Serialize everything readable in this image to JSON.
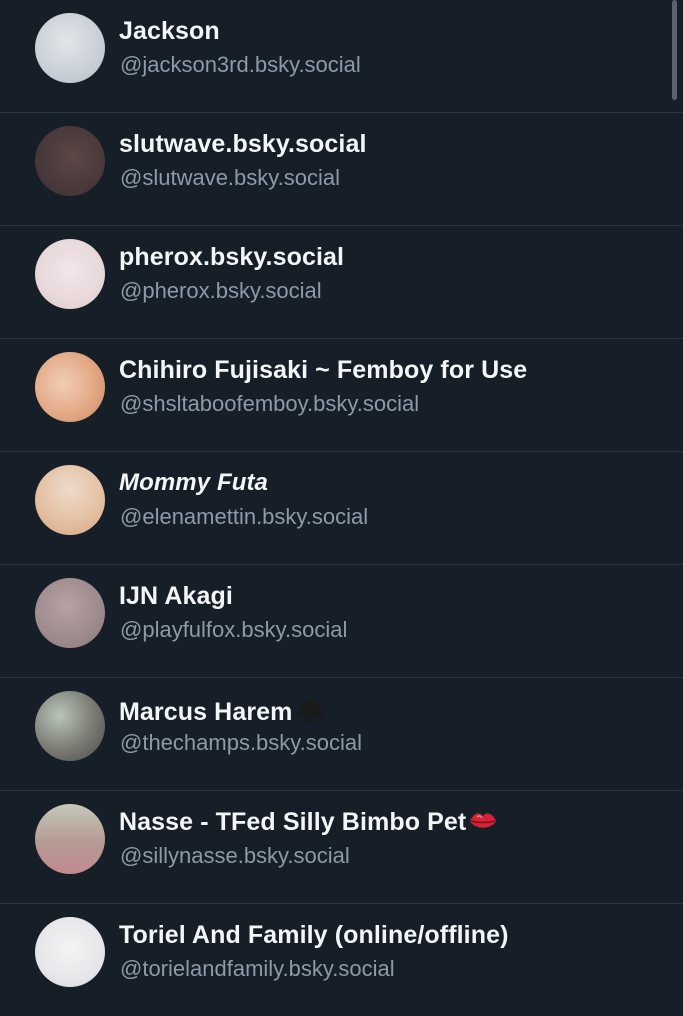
{
  "accounts": [
    {
      "name": "Jackson",
      "handle": "@jackson3rd.bsky.social"
    },
    {
      "name": "slutwave.bsky.social",
      "handle": "@slutwave.bsky.social"
    },
    {
      "name": "pherox.bsky.social",
      "handle": "@pherox.bsky.social"
    },
    {
      "name": "Chihiro Fujisaki ~ Femboy for Use",
      "handle": "@shsltaboofemboy.bsky.social"
    },
    {
      "name": "Mommy Futa",
      "handle": "@elenamettin.bsky.social"
    },
    {
      "name": "IJN Akagi",
      "handle": "@playfulfox.bsky.social"
    },
    {
      "name": "Marcus Harem",
      "name_suffix_icon": "spade-icon",
      "handle": "@thechamps.bsky.social"
    },
    {
      "name": "Nasse - TFed Silly Bimbo Pet",
      "name_suffix_icon": "lips-icon",
      "handle": "@sillynasse.bsky.social"
    },
    {
      "name": "Toriel And Family (online/offline)",
      "handle": "@torielandfamily.bsky.social"
    }
  ],
  "colors": {
    "background": "#161e27",
    "name_text": "#f3f5f7",
    "handle_text": "#8d9aa8",
    "divider": "#2b3540"
  }
}
